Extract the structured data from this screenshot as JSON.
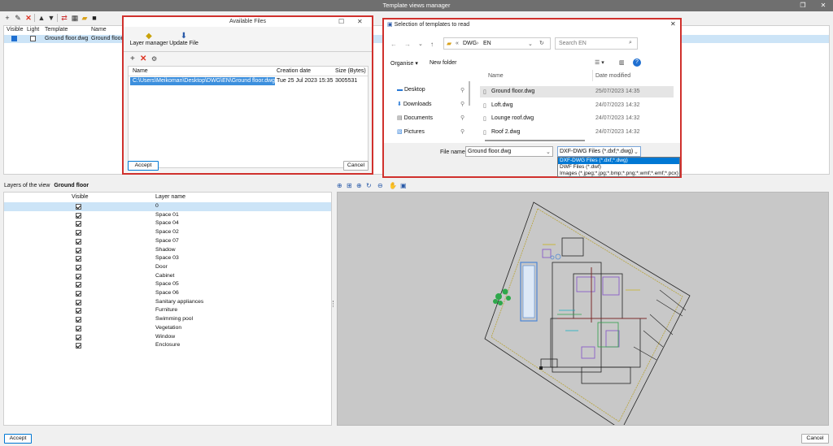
{
  "window": {
    "title": "Template views manager"
  },
  "toolbar": {
    "icons": [
      "add-icon",
      "edit-icon",
      "delete-icon",
      "move-up-icon",
      "move-down-icon",
      "refresh-icon",
      "layers-icon",
      "open-folder-icon",
      "save-icon"
    ]
  },
  "templates": {
    "columns": [
      "Visible",
      "Light",
      "Template",
      "Name"
    ],
    "rows": [
      {
        "visible": true,
        "light": false,
        "template": "Ground floor.dwg",
        "name": "Ground floor"
      }
    ]
  },
  "layers": {
    "title_label": "Layers of the view",
    "title_value": "Ground floor",
    "col_visible": "Visible",
    "col_name": "Layer name",
    "items": [
      "0",
      "Space 01",
      "Space 04",
      "Space 02",
      "Space 07",
      "Shadow",
      "Space 03",
      "Door",
      "Cabinet",
      "Space 05",
      "Space 06",
      "Sanitary appliances",
      "Furniture",
      "Swimming pool",
      "Vegetation",
      "Window",
      "Enclosure"
    ]
  },
  "view_tools": [
    "zoom-window-icon",
    "zoom-all-icon",
    "zoom-in-icon",
    "zoom-refresh-icon",
    "zoom-out-icon",
    "pan-icon",
    "fit-icon"
  ],
  "available_files": {
    "title": "Available Files",
    "layer_manager": "Layer manager",
    "update_file": "Update File",
    "columns": [
      "Name",
      "Creation date",
      "Size (Bytes)"
    ],
    "rows": [
      {
        "name": "C:\\Users\\Meikoman\\Desktop\\DWG\\EN\\Ground floor.dwg",
        "date": "Tue 25 Jul 2023  15:35",
        "size": "3005531"
      }
    ],
    "accept": "Accept",
    "cancel": "Cancel"
  },
  "file_picker": {
    "title": "Selection of templates to read",
    "path": [
      "DWG",
      "EN"
    ],
    "search_placeholder": "Search EN",
    "organise": "Organise",
    "new_folder": "New folder",
    "nav": [
      "Desktop",
      "Downloads",
      "Documents",
      "Pictures"
    ],
    "col_name": "Name",
    "col_date": "Date modified",
    "files": [
      {
        "name": "Ground floor.dwg",
        "date": "25/07/2023 14:35"
      },
      {
        "name": "Loft.dwg",
        "date": "24/07/2023 14:32"
      },
      {
        "name": "Lounge roof.dwg",
        "date": "24/07/2023 14:32"
      },
      {
        "name": "Roof 2.dwg",
        "date": "24/07/2023 14:32"
      }
    ],
    "file_name_label": "File name:",
    "file_name_value": "Ground floor.dwg",
    "filter_value": "DXF-DWG Files (*.dxf;*.dwg)",
    "filter_options": [
      "DXF-DWG Files (*.dxf;*.dwg)",
      "DWF Files (*.dwf)",
      "Images (*.jpeg;*.jpg;*.bmp;*.png;*.wmf;*.emf;*.pcx)"
    ]
  },
  "footer": {
    "accept": "Accept",
    "cancel": "Cancel"
  },
  "colors": {
    "accent": "#0078d4",
    "highlight": "#d0312d",
    "selection": "#cce4f7"
  }
}
